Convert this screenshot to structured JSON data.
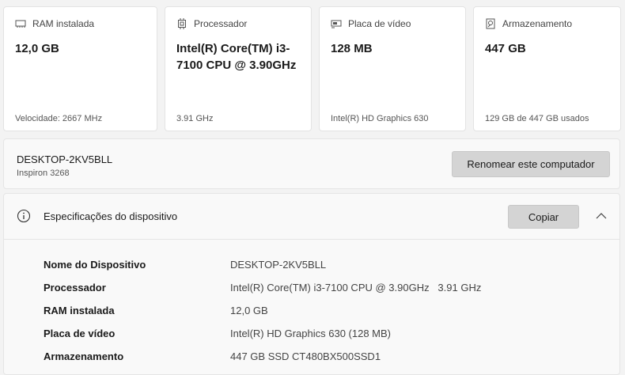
{
  "cards": [
    {
      "icon": "ram-icon",
      "label": "RAM instalada",
      "value": "12,0 GB",
      "footer": "Velocidade: 2667 MHz"
    },
    {
      "icon": "processor-icon",
      "label": "Processador",
      "value": "Intel(R) Core(TM) i3-7100 CPU @ 3.90GHz",
      "footer": "3.91 GHz"
    },
    {
      "icon": "gpu-icon",
      "label": "Placa de vídeo",
      "value": "128 MB",
      "footer": "Intel(R) HD Graphics 630"
    },
    {
      "icon": "storage-icon",
      "label": "Armazenamento",
      "value": "447 GB",
      "footer": "129 GB de 447 GB usados"
    }
  ],
  "computer": {
    "name": "DESKTOP-2KV5BLL",
    "model": "Inspiron 3268",
    "rename_label": "Renomear este computador"
  },
  "specs": {
    "title": "Especificações do dispositivo",
    "copy_label": "Copiar",
    "rows": [
      {
        "key": "Nome do Dispositivo",
        "value": "DESKTOP-2KV5BLL"
      },
      {
        "key": "Processador",
        "value": "Intel(R) Core(TM) i3-7100 CPU @ 3.90GHz   3.91 GHz"
      },
      {
        "key": "RAM instalada",
        "value": "12,0 GB"
      },
      {
        "key": "Placa de vídeo",
        "value": "Intel(R) HD Graphics 630 (128 MB)"
      },
      {
        "key": "Armazenamento",
        "value": "447 GB SSD CT480BX500SSD1"
      }
    ]
  }
}
